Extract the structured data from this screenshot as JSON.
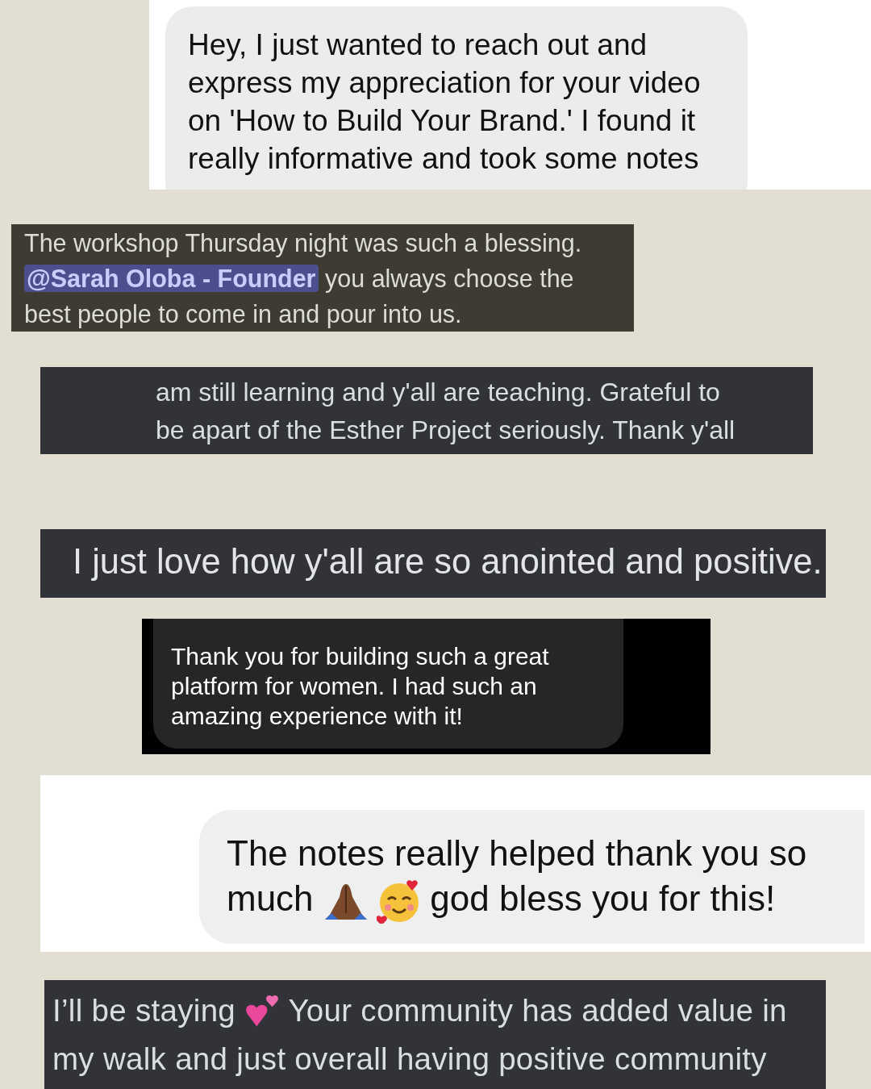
{
  "cards": [
    {
      "kind": "ios-bubble",
      "segments": [
        {
          "kind": "line",
          "text": "Hey, I just wanted to reach out and"
        },
        {
          "kind": "line",
          "text": "express my appreciation for your video"
        },
        {
          "kind": "line",
          "text": "on 'How to Build Your Brand.' I found it"
        },
        {
          "kind": "line",
          "text": "really informative and took some notes"
        }
      ]
    },
    {
      "kind": "discord-olive",
      "segments": [
        {
          "kind": "line",
          "text": "The workshop Thursday night was such a blessing."
        },
        {
          "kind": "mention",
          "text": "@Sarah Oloba - Founder"
        },
        {
          "kind": "text",
          "text": "you always choose the"
        },
        {
          "kind": "line",
          "text": "best people to come in and pour into us."
        }
      ]
    },
    {
      "kind": "discord",
      "segments": [
        {
          "kind": "line",
          "text": "am still learning and y'all are teaching. Grateful to"
        },
        {
          "kind": "line",
          "text": "be apart of the Esther Project seriously. Thank y'all"
        }
      ]
    },
    {
      "kind": "discord-large",
      "segments": [
        {
          "kind": "line",
          "text": "I just love how y'all are so anointed and positive."
        }
      ]
    },
    {
      "kind": "dark-bubble",
      "segments": [
        {
          "kind": "line",
          "text": "Thank you for building such a great"
        },
        {
          "kind": "line",
          "text": "platform for women. I had such an"
        },
        {
          "kind": "line",
          "text": "amazing experience with it!"
        }
      ]
    },
    {
      "kind": "light-bubble",
      "segments": [
        {
          "kind": "line",
          "text": "The notes really helped thank you so"
        },
        {
          "kind": "text",
          "text": "much"
        },
        {
          "kind": "hands"
        },
        {
          "kind": "blush"
        },
        {
          "kind": "text",
          "text": "god bless you for this!"
        }
      ]
    },
    {
      "kind": "discord-xl",
      "segments": [
        {
          "kind": "text",
          "text": "I’ll be staying"
        },
        {
          "kind": "hearts"
        },
        {
          "kind": "text",
          "text": "Your community has added value in"
        },
        {
          "kind": "line",
          "text": "my walk and just overall having positive community"
        }
      ]
    }
  ]
}
